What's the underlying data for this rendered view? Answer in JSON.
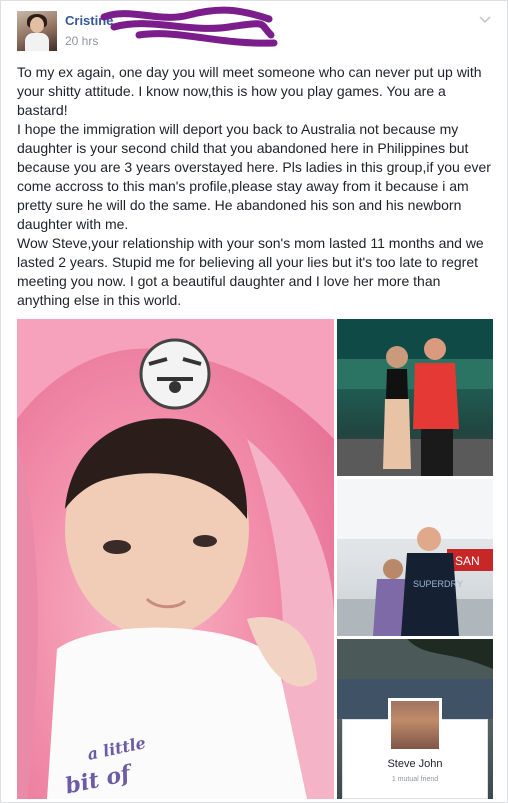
{
  "post": {
    "author": "Cristine",
    "timestamp": "20 hrs",
    "paragraphs": [
      "To my ex again, one day you will meet someone who can never put up with your shitty attitude. I know now,this is how you play games. You are a bastard!",
      "I hope the immigration will deport you back to Australia not because my daughter is your second child that you abandoned here in Philippines but because you are 3 years overstayed here. Pls ladies in this group,if you ever come accross to this man's profile,please stay away from it because i am pretty sure he will do the same. He abandoned his son and his newborn daughter with me.",
      "Wow Steve,your relationship with your son's mom lasted 11 months and we lasted 2 years. Stupid me for believing all your lies but it's too late to regret meeting you now. I got a beautiful daughter and I love her more than anything else in this world."
    ]
  },
  "photos": {
    "profile_card": {
      "name": "Steve John",
      "subtitle": "1 mutual friend"
    },
    "baby_shirt_text_1": "a little",
    "baby_shirt_text_2": "bit of",
    "store_sign": "SAN"
  },
  "colors": {
    "link_blue": "#365899",
    "scribble_purple": "#7b1e8c",
    "meta_gray": "#90949c"
  },
  "icons": [
    "chevron-down-icon"
  ]
}
